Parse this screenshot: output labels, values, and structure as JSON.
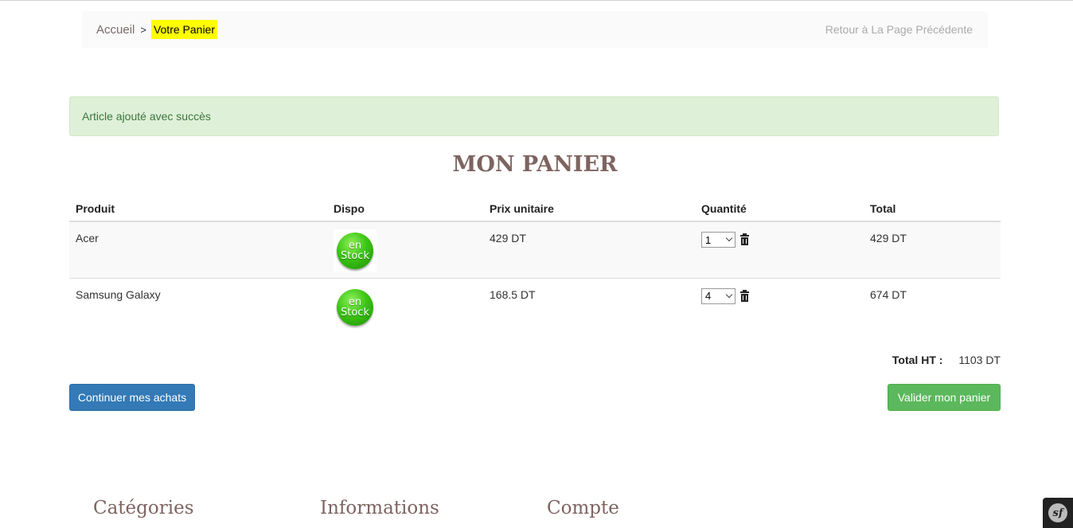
{
  "breadcrumb": {
    "home": "Accueil",
    "separator": ">",
    "current": "Votre Panier",
    "back": "Retour à La Page Précédente"
  },
  "alert": {
    "message": "Article ajouté avec succès",
    "color": "#3c763d",
    "background": "#dff0d8"
  },
  "cart": {
    "title": "MON PANIER",
    "columns": [
      "Produit",
      "Dispo",
      "Prix unitaire",
      "Quantité",
      "Total"
    ],
    "rows": [
      {
        "produit": "Acer",
        "dispo_line1": "en",
        "dispo_line2": "Stock",
        "prix": "429 DT",
        "quantite": "1",
        "total": "429 DT"
      },
      {
        "produit": "Samsung Galaxy",
        "dispo_line1": "en",
        "dispo_line2": "Stock",
        "prix": "168.5 DT",
        "quantite": "4",
        "total": "674 DT"
      }
    ],
    "total_label": "Total HT :",
    "total_value": "1103 DT"
  },
  "buttons": {
    "continue": "Continuer mes achats",
    "validate": "Valider mon panier",
    "continue_color": "#337ab7",
    "validate_color": "#5cb85c"
  },
  "footer": {
    "categories": "Catégories",
    "informations": "Informations",
    "compte": "Compte"
  },
  "debug_toolbar": {
    "logo_text": "sf",
    "icon": "symfony-icon"
  }
}
